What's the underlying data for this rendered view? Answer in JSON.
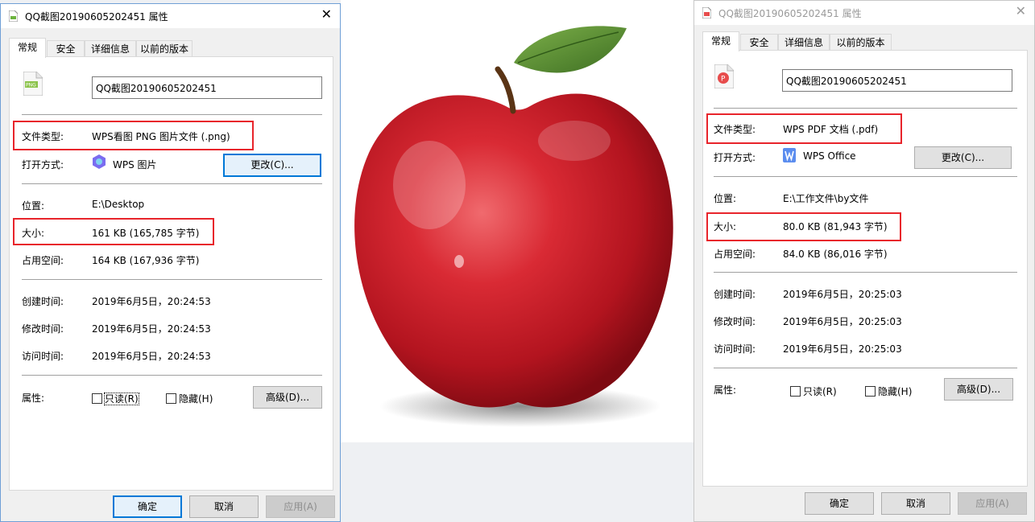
{
  "left_dialog": {
    "title": "QQ截图20190605202451 属性",
    "tabs": [
      "常规",
      "安全",
      "详细信息",
      "以前的版本"
    ],
    "filename": "QQ截图20190605202451",
    "file_icon": "png-file-icon",
    "file_type_label": "文件类型:",
    "file_type_value": "WPS看图 PNG 图片文件 (.png)",
    "open_with_label": "打开方式:",
    "open_with_app": "WPS 图片",
    "change_button": "更改(C)...",
    "location_label": "位置:",
    "location_value": "E:\\Desktop",
    "size_label": "大小:",
    "size_value": "161 KB (165,785 字节)",
    "disk_size_label": "占用空间:",
    "disk_size_value": "164 KB (167,936 字节)",
    "created_label": "创建时间:",
    "created_value": "2019年6月5日，20:24:53",
    "modified_label": "修改时间:",
    "modified_value": "2019年6月5日，20:24:53",
    "accessed_label": "访问时间:",
    "accessed_value": "2019年6月5日，20:24:53",
    "attributes_label": "属性:",
    "readonly_label": "只读(R)",
    "hidden_label": "隐藏(H)",
    "advanced_button": "高级(D)...",
    "ok_button": "确定",
    "cancel_button": "取消",
    "apply_button": "应用(A)"
  },
  "right_dialog": {
    "title": "QQ截图20190605202451 属性",
    "tabs": [
      "常规",
      "安全",
      "详细信息",
      "以前的版本"
    ],
    "filename": "QQ截图20190605202451",
    "file_icon": "pdf-file-icon",
    "file_type_label": "文件类型:",
    "file_type_value": "WPS PDF 文档 (.pdf)",
    "open_with_label": "打开方式:",
    "open_with_app": "WPS Office",
    "change_button": "更改(C)...",
    "location_label": "位置:",
    "location_value": "E:\\工作文件\\by文件",
    "size_label": "大小:",
    "size_value": "80.0 KB (81,943 字节)",
    "disk_size_label": "占用空间:",
    "disk_size_value": "84.0 KB (86,016 字节)",
    "created_label": "创建时间:",
    "created_value": "2019年6月5日，20:25:03",
    "modified_label": "修改时间:",
    "modified_value": "2019年6月5日，20:25:03",
    "accessed_label": "访问时间:",
    "accessed_value": "2019年6月5日，20:25:03",
    "attributes_label": "属性:",
    "readonly_label": "只读(R)",
    "hidden_label": "隐藏(H)",
    "advanced_button": "高级(D)...",
    "ok_button": "确定",
    "cancel_button": "取消",
    "apply_button": "应用(A)"
  },
  "colors": {
    "highlight": "#e8242b",
    "focus_blue": "#0078d7",
    "apple_red": "#c8202c",
    "leaf_green": "#5f8f3a"
  },
  "center_image": "red-apple"
}
